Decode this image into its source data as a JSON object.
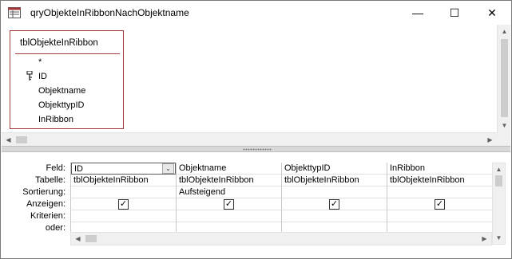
{
  "window": {
    "title": "qryObjekteInRibbonNachObjektname",
    "minimize_glyph": "—",
    "maximize_glyph": "☐",
    "close_glyph": "✕"
  },
  "table": {
    "name": "tblObjekteInRibbon",
    "fields": [
      "*",
      "ID",
      "Objektname",
      "ObjekttypID",
      "InRibbon"
    ]
  },
  "grid": {
    "row_labels": [
      "Feld:",
      "Tabelle:",
      "Sortierung:",
      "Anzeigen:",
      "Kriterien:",
      "oder:"
    ],
    "columns": [
      {
        "feld": "ID",
        "tabelle": "tblObjekteInRibbon",
        "sortierung": "",
        "anzeigen": true
      },
      {
        "feld": "Objektname",
        "tabelle": "tblObjekteInRibbon",
        "sortierung": "Aufsteigend",
        "anzeigen": true
      },
      {
        "feld": "ObjekttypID",
        "tabelle": "tblObjekteInRibbon",
        "sortierung": "",
        "anzeigen": true
      },
      {
        "feld": "InRibbon",
        "tabelle": "tblObjekteInRibbon",
        "sortierung": "",
        "anzeigen": true
      }
    ]
  },
  "icons": {
    "app": "query-window-icon",
    "key": "primary-key-icon",
    "checked_glyph": "✓"
  },
  "colors": {
    "table_border": "#a4373a"
  }
}
